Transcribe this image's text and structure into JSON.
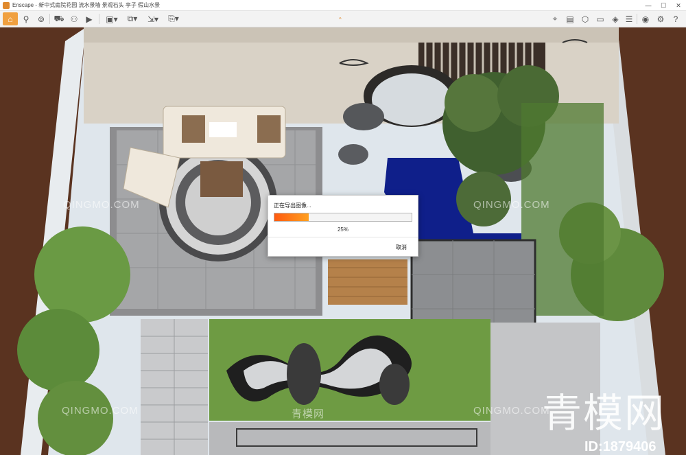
{
  "window": {
    "app_name": "Enscape",
    "title": "Enscape - 新中式庭院花园 流水景墙 景观石头 亭子 假山水景",
    "controls": {
      "minimize": "—",
      "maximize": "☐",
      "close": "✕"
    }
  },
  "toolbar": {
    "left_icons": [
      "home-icon",
      "walk-icon",
      "binoculars-icon",
      "car-icon",
      "person-icon",
      "video-icon",
      "box-icon",
      "screenshot-icon",
      "export-icon",
      "panorama-icon"
    ],
    "right_icons": [
      "map-icon",
      "display-icon",
      "cube-icon",
      "monitor-icon",
      "palette-icon",
      "layers-icon",
      "settings-icon",
      "eye-icon",
      "gear-icon",
      "help-icon"
    ],
    "center_caret": "^"
  },
  "dialog": {
    "title": "正在导出图像...",
    "progress_percent": 25,
    "progress_label": "25%",
    "cancel_label": "取消"
  },
  "watermarks": {
    "text": "QINGMO.COM",
    "text_cn": "青模网",
    "brand": "青模网",
    "id_label": "ID:1879406"
  },
  "colors": {
    "accent": "#f0a040",
    "progress_start": "#ff5a10",
    "progress_end": "#ffa020"
  }
}
